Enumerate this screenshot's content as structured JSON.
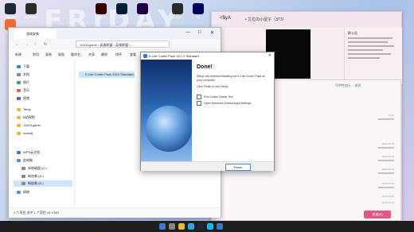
{
  "desktop": {
    "watermark": "FRIDAY",
    "icons": [
      {
        "label": "Steam",
        "color": "#1b2838"
      },
      {
        "label": "Origin",
        "color": "#f56c2d"
      },
      {
        "label": "WeGame",
        "color": "#2b2b2b"
      },
      {
        "label": "Ai",
        "color": "#330000"
      },
      {
        "label": "Ps",
        "color": "#001e36"
      },
      {
        "label": "Ae",
        "color": "#1f0040"
      },
      {
        "label": "Adobe",
        "color": "#2a2a2a"
      },
      {
        "label": "Pr",
        "color": "#00005b"
      }
    ]
  },
  "chat": {
    "title": "<$yA",
    "name": "• 艾拉の小屋子（373）",
    "side_title": "群公告",
    "panel_head": "可甲性加入... 成员",
    "send_label": "发送(S)",
    "times": [
      "21:11",
      "2022-05-18",
      "2022-05-19",
      "2022-05-24",
      "2022-05-31",
      "2022-06-05",
      "2022-06-12"
    ]
  },
  "explorer": {
    "tab_label": "游戏安装",
    "address": "111111game › 英雄联盟 › 英雄联盟 › ...",
    "toolbar": [
      "新建",
      "剪切",
      "复制",
      "粘贴",
      "重命名",
      "共享",
      "删除",
      "排序",
      "查看"
    ],
    "nav_items": [
      {
        "label": "下载",
        "color": "#2e87d6"
      },
      {
        "label": "文档",
        "color": "#7a8aa0"
      },
      {
        "label": "图片",
        "color": "#3da36a"
      },
      {
        "label": "音乐",
        "color": "#e06a4a"
      },
      {
        "label": "视频",
        "color": "#7b4fc4"
      },
      {
        "label": "Temp",
        "color": "#e7b93c"
      },
      {
        "label": "B站视频",
        "color": "#e7b93c"
      },
      {
        "label": "111111game",
        "color": "#e7b93c"
      },
      {
        "label": "xcxlxdj",
        "color": "#e7b93c"
      },
      {
        "label": "WPS云文档",
        "color": "#3a7ad6"
      },
      {
        "label": "此电脑",
        "color": "#5a8fd0"
      },
      {
        "label": "本地磁盘 (C:)",
        "color": "#888888"
      },
      {
        "label": "新加卷 (D:)",
        "color": "#888888"
      },
      {
        "label": "新加卷 (E:)",
        "color": "#888888"
      },
      {
        "label": "网络",
        "color": "#5a8fd0"
      }
    ],
    "selected_file": "K-Lite Codec Pack 1612 Standard.exe",
    "status": "1 个项目    选中 1 个项目  54.9 MB"
  },
  "setup": {
    "title": "K-Lite Codec Pack 16.1.2 Standard",
    "heading": "Done!",
    "paragraph1": "Setup has finished installing the K-Lite Codec Pack on your computer.",
    "paragraph2": "Click Finish to exit Setup.",
    "option1": "Run Codec Tweak Tool",
    "option2": "Open Windows Default Apps settings",
    "finish": "Finish"
  }
}
